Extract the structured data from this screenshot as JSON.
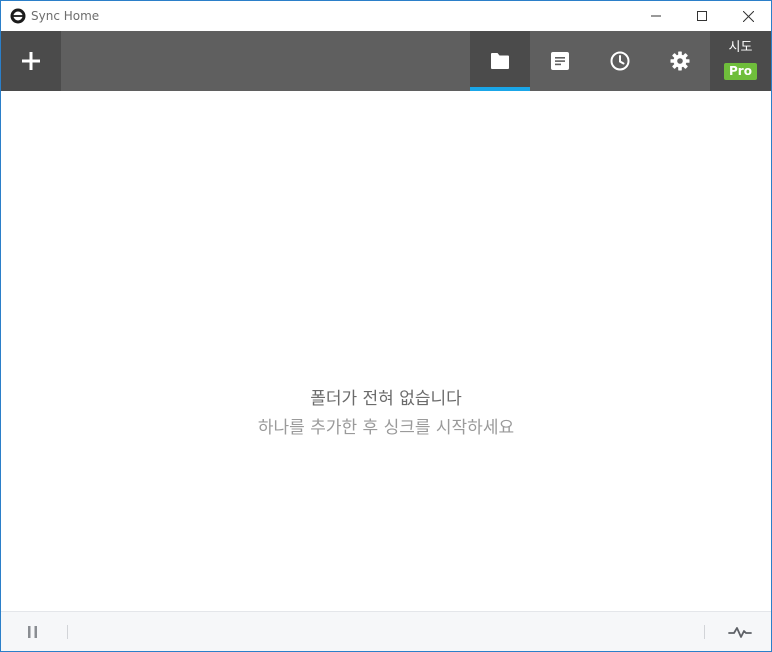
{
  "window": {
    "title": "Sync Home"
  },
  "toolbar": {
    "tabs": [
      {
        "name": "folders",
        "icon": "folder-icon",
        "active": true
      },
      {
        "name": "notes",
        "icon": "notes-icon",
        "active": false
      },
      {
        "name": "history",
        "icon": "clock-icon",
        "active": false
      },
      {
        "name": "settings",
        "icon": "gear-icon",
        "active": false
      }
    ],
    "trial_label": "시도",
    "pro_badge": "Pro"
  },
  "main": {
    "empty_title": "폴더가 전혀 없습니다",
    "empty_subtitle": "하나를 추가한 후 싱크를 시작하세요"
  },
  "colors": {
    "toolbar_bg": "#5f5f5f",
    "toolbar_active_bg": "#4b4b4b",
    "active_indicator": "#1aa6e8",
    "pro_badge": "#6fbe3b",
    "window_border": "#2b7fc9"
  }
}
